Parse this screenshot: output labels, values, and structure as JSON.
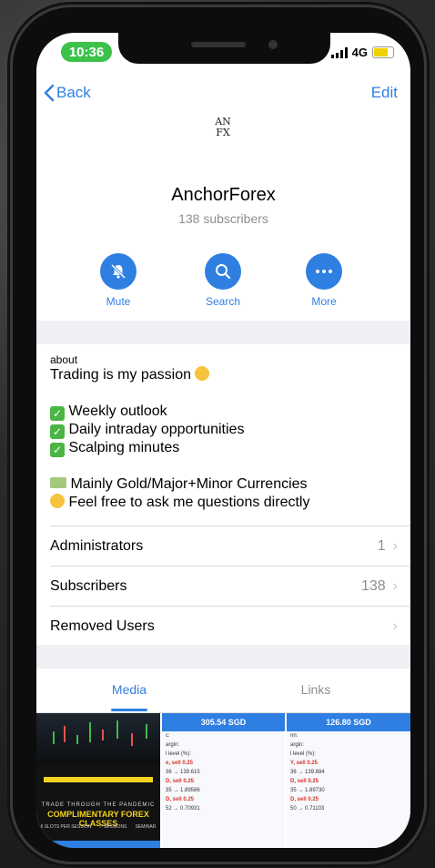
{
  "status": {
    "time": "10:36",
    "network": "4G"
  },
  "nav": {
    "back": "Back",
    "edit": "Edit"
  },
  "channel": {
    "logo_line1": "AN",
    "logo_line2": "FX",
    "name": "AnchorForex",
    "subscribers": "138 subscribers"
  },
  "actions": [
    {
      "label": "Mute",
      "icon": "bell-slash-icon"
    },
    {
      "label": "Search",
      "icon": "search-icon"
    },
    {
      "label": "More",
      "icon": "ellipsis-icon"
    }
  ],
  "about": {
    "header": "about",
    "lines": [
      "Trading is my passion",
      "Weekly outlook",
      "Daily intraday opportunities",
      "Scalping minutes",
      "Mainly Gold/Major+Minor Currencies",
      "Feel free to ask me questions directly"
    ]
  },
  "rows": [
    {
      "label": "Administrators",
      "value": "1"
    },
    {
      "label": "Subscribers",
      "value": "138"
    },
    {
      "label": "Removed Users",
      "value": ""
    }
  ],
  "tabs": {
    "media": "Media",
    "links": "Links"
  },
  "media": {
    "t1": {
      "sub": "TRADE THROUGH THE PANDEMIC",
      "title": "COMPLIMENTARY FOREX CLASSES",
      "col1": "6 SLOTS PER SESSION",
      "col2": "7 SESSIONS",
      "col3": "SEMINAR"
    },
    "t2": {
      "price": "305.54 SGD",
      "lines": [
        "c:",
        "argin:",
        "l level (%):",
        "",
        "e, sell 0.25",
        "36 → 139.615",
        "D, sell 0.25",
        "35 → 1.89586",
        "D, sell 0.25",
        "52 → 0.70931"
      ]
    },
    "t3": {
      "price": "126.80 SGD",
      "lines": [
        "nn:",
        "argin:",
        "l level (%):",
        "",
        "Y, sell 0.25",
        "36 → 139.884",
        "D, sell 0.25",
        "35 → 1.89730",
        "D, sell 0.25",
        "50 → 0.71103"
      ]
    }
  },
  "colors": {
    "accent": "#2f7fe3",
    "status_pill": "#3cc24a",
    "separator": "#efeff4"
  }
}
